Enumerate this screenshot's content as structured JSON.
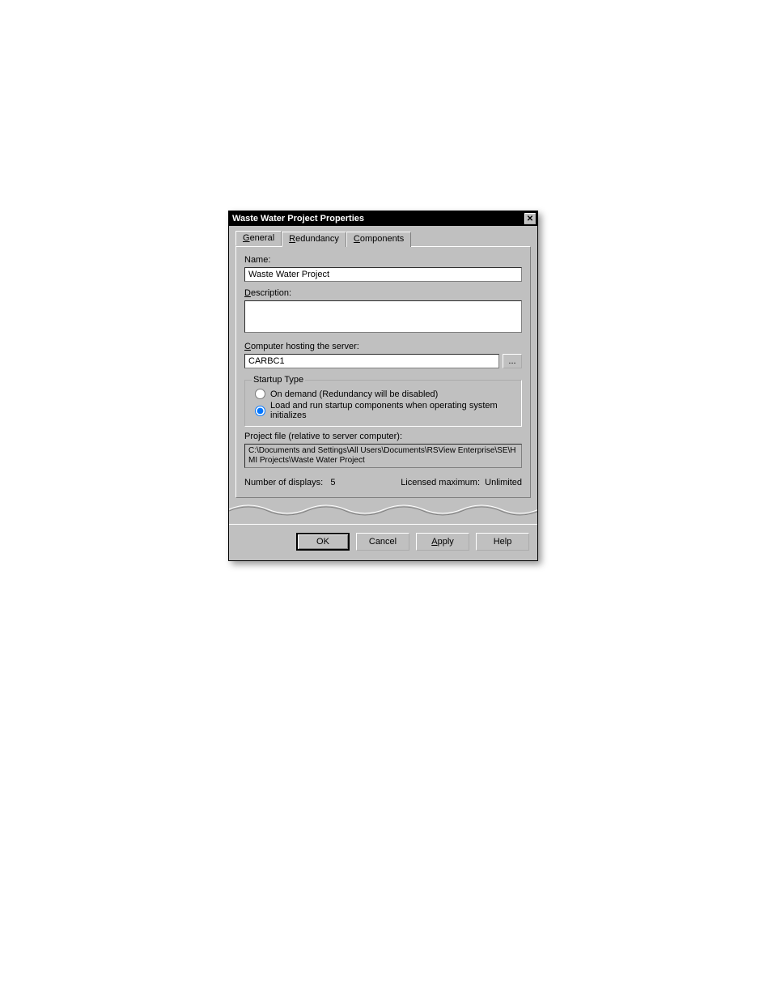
{
  "dialog": {
    "title": "Waste Water Project Properties",
    "tabs": [
      {
        "label_pre": "",
        "accel": "G",
        "label_post": "eneral"
      },
      {
        "label_pre": "",
        "accel": "R",
        "label_post": "edundancy"
      },
      {
        "label_pre": "",
        "accel": "C",
        "label_post": "omponents"
      }
    ],
    "name_label": "Name:",
    "name_value": "Waste Water Project",
    "description_label_pre": "",
    "description_accel": "D",
    "description_label_post": "escription:",
    "description_value": "",
    "host_label_pre": "",
    "host_accel": "C",
    "host_label_post": "omputer hosting the server:",
    "host_value": "CARBC1",
    "browse_label": "...",
    "startup_legend": "Startup Type",
    "radio_on_demand": "On demand (Redundancy will be disabled)",
    "radio_load_run": "Load and run startup components when operating system initializes",
    "project_file_label": "Project file (relative to server computer):",
    "project_file_value": "C:\\Documents and Settings\\All Users\\Documents\\RSView Enterprise\\SE\\HMI Projects\\Waste Water Project",
    "num_displays_label": "Number of displays:",
    "num_displays_value": "5",
    "licensed_max_label": "Licensed maximum:",
    "licensed_max_value": "Unlimited"
  },
  "buttons": {
    "ok": "OK",
    "cancel": "Cancel",
    "apply_pre": "",
    "apply_accel": "A",
    "apply_post": "pply",
    "help": "Help"
  }
}
